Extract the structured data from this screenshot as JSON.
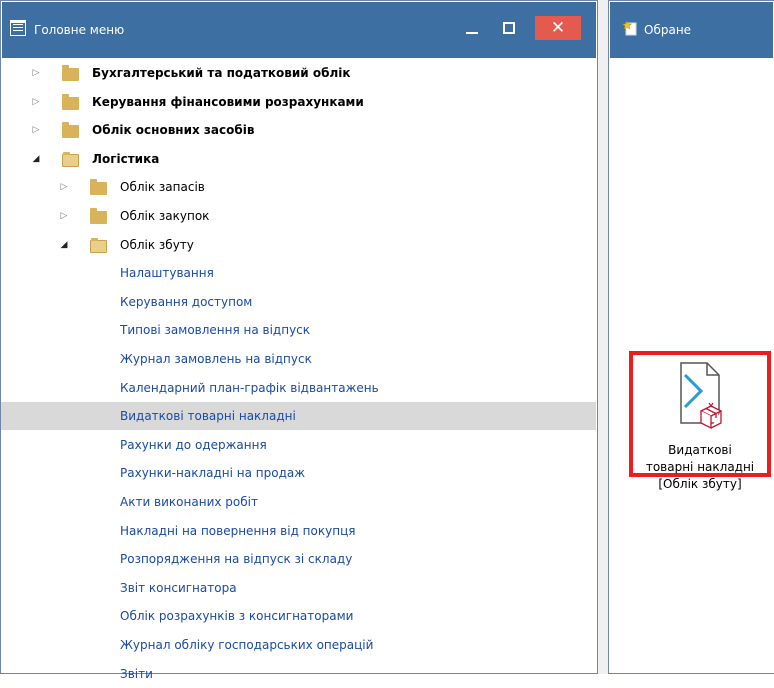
{
  "main_menu": {
    "title": "Головне меню",
    "close_glyph": "✕",
    "tree": [
      {
        "label": "Бухгалтерський та податковий облік",
        "level": 0,
        "type": "folder",
        "expanded": false,
        "bold": true
      },
      {
        "label": "Керування фінансовими розрахунками",
        "level": 0,
        "type": "folder",
        "expanded": false,
        "bold": true
      },
      {
        "label": "Облік основних засобів",
        "level": 0,
        "type": "folder",
        "expanded": false,
        "bold": true
      },
      {
        "label": "Логістика",
        "level": 0,
        "type": "folder",
        "expanded": true,
        "bold": true
      },
      {
        "label": "Облік запасів",
        "level": 1,
        "type": "folder",
        "expanded": false
      },
      {
        "label": "Облік закупок",
        "level": 1,
        "type": "folder",
        "expanded": false
      },
      {
        "label": "Облік збуту",
        "level": 1,
        "type": "folder",
        "expanded": true
      },
      {
        "label": "Налаштування",
        "level": 2,
        "type": "item"
      },
      {
        "label": "Керування доступом",
        "level": 2,
        "type": "item"
      },
      {
        "label": "Типові замовлення на відпуск",
        "level": 2,
        "type": "item"
      },
      {
        "label": "Журнал замовлень на відпуск",
        "level": 2,
        "type": "item"
      },
      {
        "label": "Календарний план-графік відвантажень",
        "level": 2,
        "type": "item"
      },
      {
        "label": "Видаткові товарні накладні",
        "level": 2,
        "type": "item",
        "selected": true
      },
      {
        "label": "Рахунки до одержання",
        "level": 2,
        "type": "item"
      },
      {
        "label": "Рахунки-накладні на продаж",
        "level": 2,
        "type": "item"
      },
      {
        "label": "Акти виконаних робіт",
        "level": 2,
        "type": "item"
      },
      {
        "label": "Накладні на повернення від покупця",
        "level": 2,
        "type": "item"
      },
      {
        "label": "Розпорядження на відпуск зі складу",
        "level": 2,
        "type": "item"
      },
      {
        "label": "Звіт консигнатора",
        "level": 2,
        "type": "item"
      },
      {
        "label": "Облік розрахунків з консигнаторами",
        "level": 2,
        "type": "item"
      },
      {
        "label": "Журнал обліку господарських операцій",
        "level": 2,
        "type": "item"
      },
      {
        "label": "Звіти",
        "level": 2,
        "type": "item"
      }
    ]
  },
  "favorites": {
    "title": "Обране",
    "tile": {
      "line1": "Видаткові",
      "line2": "товарні накладні",
      "line3": "[Облік збуту]"
    }
  },
  "colors": {
    "titlebar": "#3d6fa3",
    "close": "#e55a4e",
    "link": "#1a4aa6",
    "highlight": "#ee1c1c",
    "selected_row": "#d9d9d9"
  }
}
